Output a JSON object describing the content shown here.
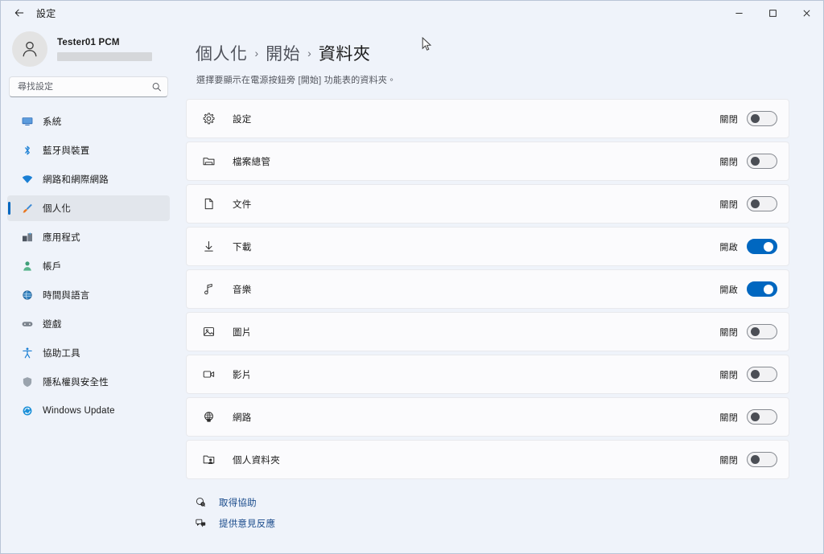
{
  "titlebar": {
    "back_label": "返回",
    "title": "設定",
    "minimize_label": "最小化",
    "maximize_label": "最大化",
    "close_label": "關閉"
  },
  "account": {
    "name": "Tester01 PCM",
    "email_redacted": ""
  },
  "search": {
    "placeholder": "尋找設定",
    "value": "",
    "icon": "search-icon"
  },
  "sidebar": {
    "items": [
      {
        "label": "系統",
        "icon": "display-icon",
        "selected": false
      },
      {
        "label": "藍牙與裝置",
        "icon": "bluetooth-icon",
        "selected": false
      },
      {
        "label": "網路和網際網路",
        "icon": "wifi-icon",
        "selected": false
      },
      {
        "label": "個人化",
        "icon": "paintbrush-icon",
        "selected": true
      },
      {
        "label": "應用程式",
        "icon": "apps-icon",
        "selected": false
      },
      {
        "label": "帳戶",
        "icon": "account-icon",
        "selected": false
      },
      {
        "label": "時間與語言",
        "icon": "clock-globe-icon",
        "selected": false
      },
      {
        "label": "遊戲",
        "icon": "gamepad-icon",
        "selected": false
      },
      {
        "label": "協助工具",
        "icon": "accessibility-icon",
        "selected": false
      },
      {
        "label": "隱私權與安全性",
        "icon": "shield-icon",
        "selected": false
      },
      {
        "label": "Windows Update",
        "icon": "update-icon",
        "selected": false
      }
    ]
  },
  "page": {
    "breadcrumb": [
      "個人化",
      "開始",
      "資料夾"
    ],
    "breadcrumb_separator": "›",
    "subtitle": "選擇要顯示在電源按鈕旁 [開始] 功能表的資料夾。"
  },
  "folders": [
    {
      "label": "設定",
      "icon": "gear-icon",
      "state": "關閉",
      "on": false
    },
    {
      "label": "檔案總管",
      "icon": "folder-icon",
      "state": "關閉",
      "on": false
    },
    {
      "label": "文件",
      "icon": "document-icon",
      "state": "關閉",
      "on": false
    },
    {
      "label": "下載",
      "icon": "download-icon",
      "state": "開啟",
      "on": true
    },
    {
      "label": "音樂",
      "icon": "music-note-icon",
      "state": "開啟",
      "on": true
    },
    {
      "label": "圖片",
      "icon": "picture-icon",
      "state": "關閉",
      "on": false
    },
    {
      "label": "影片",
      "icon": "video-camera-icon",
      "state": "關閉",
      "on": false
    },
    {
      "label": "網路",
      "icon": "network-globe-icon",
      "state": "關閉",
      "on": false
    },
    {
      "label": "個人資料夾",
      "icon": "personal-folder-icon",
      "state": "關閉",
      "on": false
    }
  ],
  "footer": [
    {
      "label": "取得協助",
      "icon": "help-icon"
    },
    {
      "label": "提供意見反應",
      "icon": "feedback-icon"
    }
  ],
  "colors": {
    "accent": "#0067c0",
    "page_bg": "#eff3fa",
    "card_bg": "#fbfbfd",
    "selected_nav_bg": "#e2e6ec",
    "link": "#1b4c8c"
  }
}
